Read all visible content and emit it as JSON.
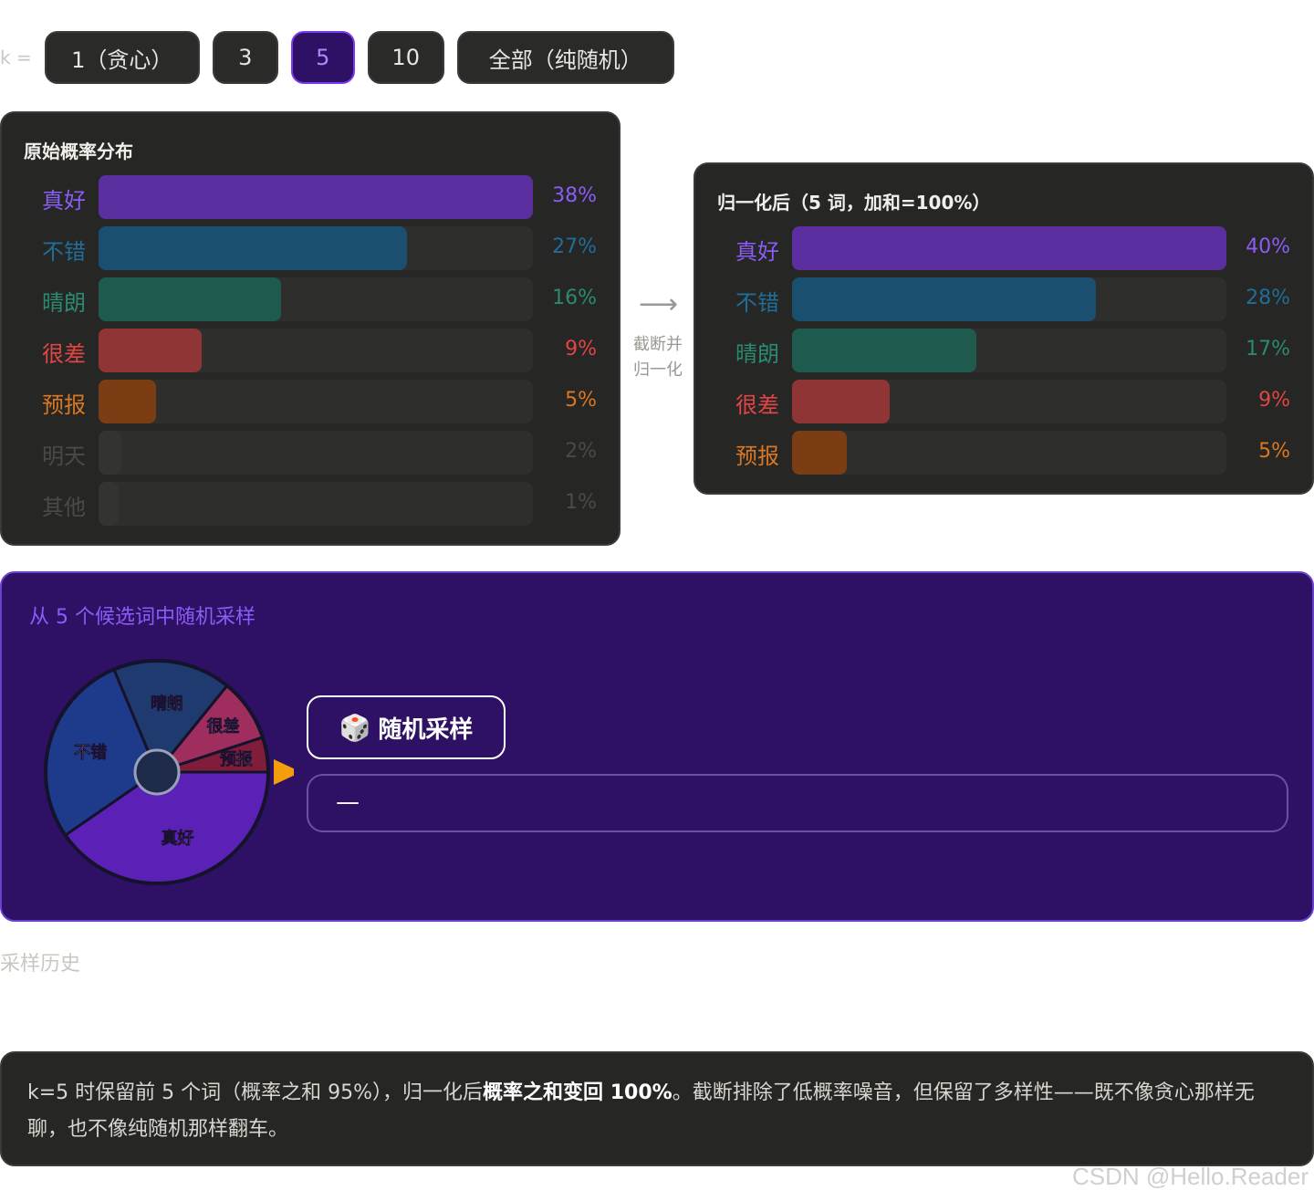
{
  "k_selector": {
    "label": "k =",
    "options": [
      "1（贪心）",
      "3",
      "5",
      "10",
      "全部（纯随机）"
    ],
    "selected_index": 2
  },
  "colors": {
    "good": "#5b2fa0",
    "good_text": "#8b5cf6",
    "nice": "#1a4f70",
    "nice_text": "#1f6e9a",
    "clear": "#1f5a4f",
    "clear_text": "#2a8a72",
    "bad": "#8f3535",
    "bad_text": "#e04545",
    "forecast": "#7a3d14",
    "forecast_text": "#d97722",
    "dim": "#333331",
    "dim_text": "#4a4a48"
  },
  "original": {
    "title": "原始概率分布",
    "rows": [
      {
        "label": "真好",
        "pct": "38%",
        "value": 38,
        "color": "good"
      },
      {
        "label": "不错",
        "pct": "27%",
        "value": 27,
        "color": "nice"
      },
      {
        "label": "晴朗",
        "pct": "16%",
        "value": 16,
        "color": "clear"
      },
      {
        "label": "很差",
        "pct": "9%",
        "value": 9,
        "color": "bad"
      },
      {
        "label": "预报",
        "pct": "5%",
        "value": 5,
        "color": "forecast"
      },
      {
        "label": "明天",
        "pct": "2%",
        "value": 2,
        "color": "dim"
      },
      {
        "label": "其他",
        "pct": "1%",
        "value": 1,
        "color": "dim"
      }
    ]
  },
  "arrow": {
    "symbol": "⟶",
    "line1": "截断并",
    "line2": "归一化"
  },
  "normalized": {
    "title": "归一化后（5 词，加和=100%）",
    "rows": [
      {
        "label": "真好",
        "pct": "40%",
        "value": 40,
        "color": "good"
      },
      {
        "label": "不错",
        "pct": "28%",
        "value": 28,
        "color": "nice"
      },
      {
        "label": "晴朗",
        "pct": "17%",
        "value": 17,
        "color": "clear"
      },
      {
        "label": "很差",
        "pct": "9%",
        "value": 9,
        "color": "bad"
      },
      {
        "label": "预报",
        "pct": "5%",
        "value": 5,
        "color": "forecast"
      }
    ]
  },
  "sampler": {
    "title": "从 5 个候选词中随机采样",
    "wheel_slices": [
      {
        "label": "真好",
        "value": 40,
        "color": "#5b21b6"
      },
      {
        "label": "不错",
        "value": 28,
        "color": "#1e3a8a"
      },
      {
        "label": "晴朗",
        "value": 17,
        "color": "#1e3a6e"
      },
      {
        "label": "很差",
        "value": 9,
        "color": "#9f2d5e"
      },
      {
        "label": "预报",
        "value": 5,
        "color": "#7f1d3a"
      }
    ],
    "button_label": "随机采样",
    "result": "—"
  },
  "history_label": "采样历史",
  "explanation": {
    "part1": "k=5 时保留前 5 个词（概率之和 95%），归一化后",
    "bold": "概率之和变回 100%",
    "part2": "。截断排除了低概率噪音，但保留了多样性——既不像贪心那样无聊，也不像纯随机那样翻车。"
  },
  "watermark": "CSDN @Hello.Reader"
}
